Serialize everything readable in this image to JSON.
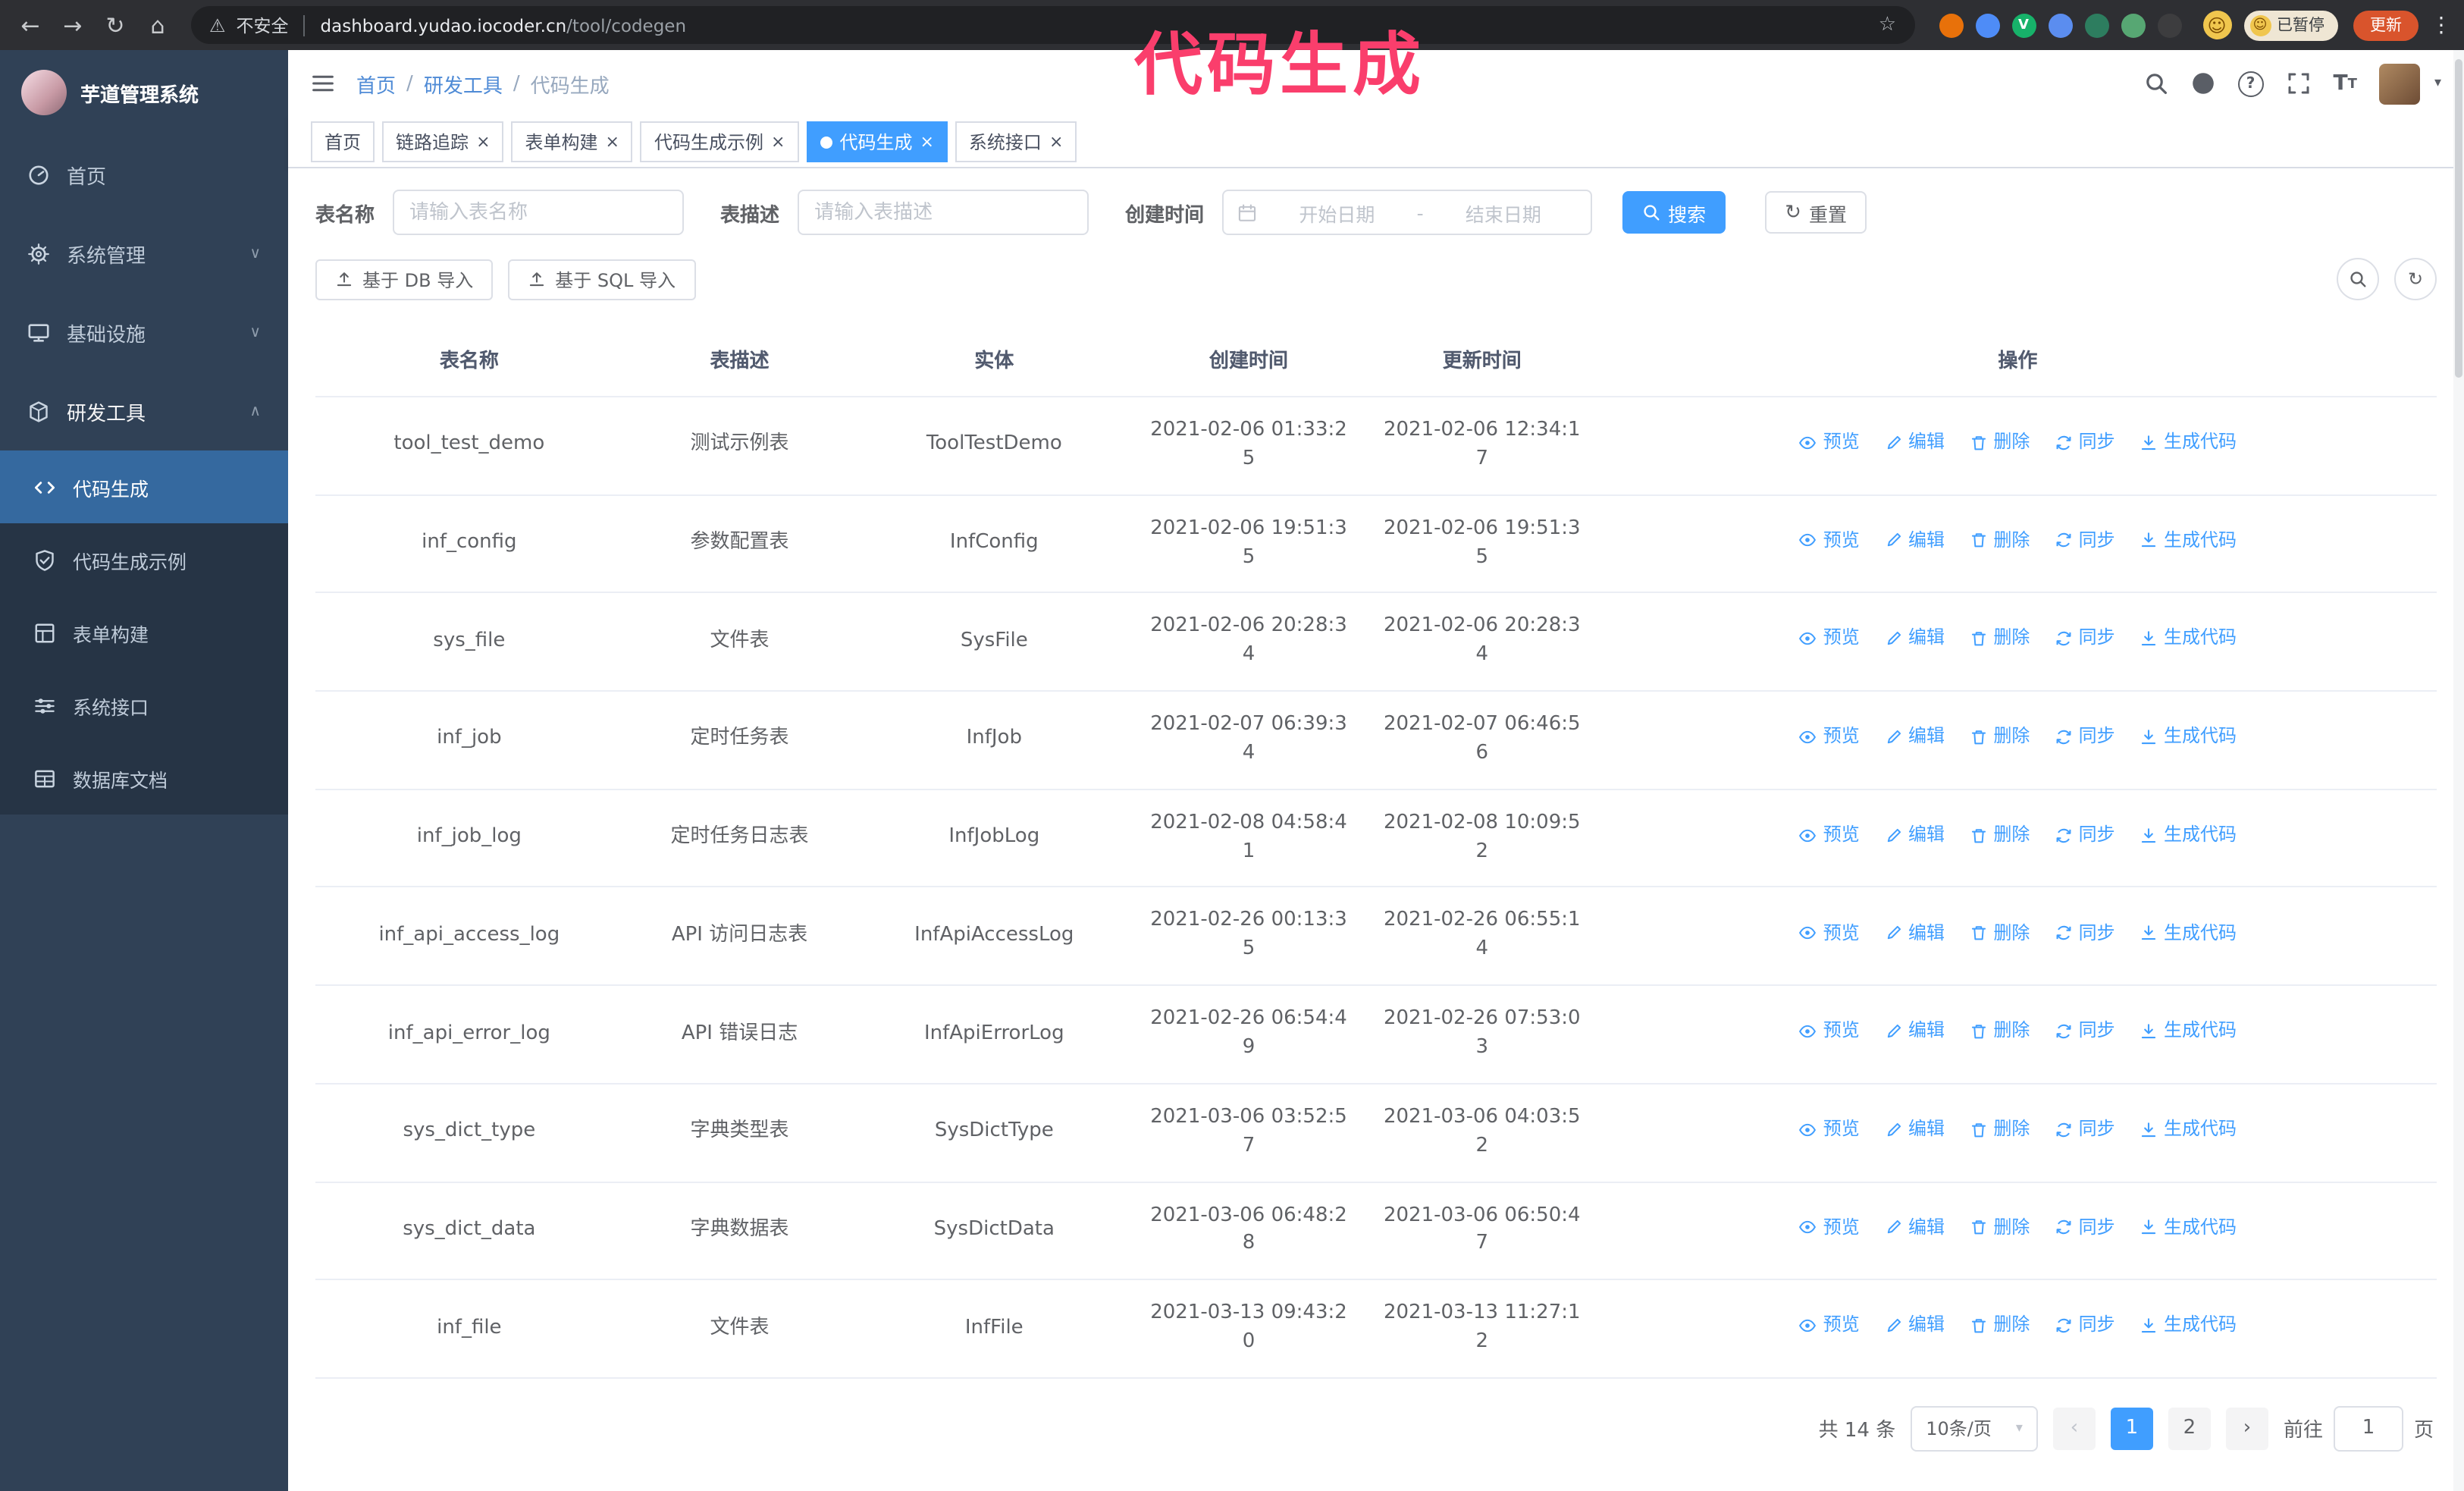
{
  "colors": {
    "accent": "#409eff",
    "sidebar_bg": "#304156",
    "sidebar_sub_bg": "#263445",
    "sidebar_active_bg": "#35699f",
    "annotation": "#fa3e6c",
    "update_button": "#d9542c",
    "chrome_bar": "#2e2f33",
    "omnibox": "#202124"
  },
  "glyphs": {
    "back": "←",
    "forward": "→",
    "reload": "↻",
    "home": "⌂",
    "warning": "⚠",
    "star": "☆",
    "menu_dots": "⋮",
    "caret": "▾",
    "prev": "‹",
    "next": "›",
    "refresh": "↻",
    "close": "×",
    "question": "?",
    "smile": "☺",
    "textsize_big": "T",
    "textsize_small": "T",
    "divider": "|"
  },
  "browser": {
    "security_label": "不安全",
    "url_domain": "dashboard.yudao.iocoder.cn",
    "url_path": "/tool/codegen",
    "paused_badge": "已暂停",
    "update_button": "更新",
    "extensions": [
      {
        "color": "#e8710a",
        "glyph": ""
      },
      {
        "color": "#4e8cf7",
        "glyph": ""
      },
      {
        "color": "#17b26a",
        "glyph": "V"
      },
      {
        "color": "#5b8def",
        "glyph": ""
      },
      {
        "color": "#2d7d5f",
        "glyph": ""
      },
      {
        "color": "#57a773",
        "glyph": ""
      },
      {
        "color": "#3d3d3f",
        "glyph": ""
      }
    ]
  },
  "annotation": {
    "text": "代码生成"
  },
  "sidebar": {
    "logo_title": "芋道管理系统",
    "items": [
      {
        "key": "home",
        "icon": "dash",
        "label": "首页",
        "type": "top"
      },
      {
        "key": "system",
        "icon": "gear",
        "label": "系统管理",
        "type": "top",
        "chevron": "down"
      },
      {
        "key": "infra",
        "icon": "monitor",
        "label": "基础设施",
        "type": "top",
        "chevron": "down"
      },
      {
        "key": "devtools",
        "icon": "tool",
        "label": "研发工具",
        "type": "top",
        "chevron": "up",
        "active": true
      },
      {
        "key": "codegen",
        "icon": "code",
        "label": "代码生成",
        "type": "sub",
        "active": true
      },
      {
        "key": "codegen-example",
        "icon": "shield",
        "label": "代码生成示例",
        "type": "sub"
      },
      {
        "key": "form-build",
        "icon": "form",
        "label": "表单构建",
        "type": "sub"
      },
      {
        "key": "api",
        "icon": "api",
        "label": "系统接口",
        "type": "sub"
      },
      {
        "key": "db-doc",
        "icon": "dbdoc",
        "label": "数据库文档",
        "type": "sub"
      }
    ]
  },
  "header": {
    "breadcrumb": [
      "首页",
      "研发工具",
      "代码生成"
    ]
  },
  "tabs": [
    {
      "key": "home",
      "label": "首页",
      "closable": false
    },
    {
      "key": "trace",
      "label": "链路追踪",
      "closable": true
    },
    {
      "key": "form-build",
      "label": "表单构建",
      "closable": true
    },
    {
      "key": "codegen-example",
      "label": "代码生成示例",
      "closable": true
    },
    {
      "key": "codegen",
      "label": "代码生成",
      "closable": true,
      "active": true
    },
    {
      "key": "api",
      "label": "系统接口",
      "closable": true
    }
  ],
  "filters": {
    "table_name_label": "表名称",
    "table_name_placeholder": "请输入表名称",
    "table_desc_label": "表描述",
    "table_desc_placeholder": "请输入表描述",
    "create_time_label": "创建时间",
    "date_start_placeholder": "开始日期",
    "date_separator": "-",
    "date_end_placeholder": "结束日期",
    "search_button": "搜索",
    "reset_button": "重置"
  },
  "toolbar": {
    "import_db_button": "基于 DB 导入",
    "import_sql_button": "基于 SQL 导入"
  },
  "table": {
    "columns": [
      "表名称",
      "表描述",
      "实体",
      "创建时间",
      "更新时间",
      "操作"
    ],
    "op_labels": {
      "preview": "预览",
      "edit": "编辑",
      "delete": "删除",
      "sync": "同步",
      "generate": "生成代码"
    },
    "rows": [
      {
        "name": "tool_test_demo",
        "desc": "测试示例表",
        "entity": "ToolTestDemo",
        "created": "2021-02-06 01:33:25",
        "updated": "2021-02-06 12:34:17"
      },
      {
        "name": "inf_config",
        "desc": "参数配置表",
        "entity": "InfConfig",
        "created": "2021-02-06 19:51:35",
        "updated": "2021-02-06 19:51:35"
      },
      {
        "name": "sys_file",
        "desc": "文件表",
        "entity": "SysFile",
        "created": "2021-02-06 20:28:34",
        "updated": "2021-02-06 20:28:34"
      },
      {
        "name": "inf_job",
        "desc": "定时任务表",
        "entity": "InfJob",
        "created": "2021-02-07 06:39:34",
        "updated": "2021-02-07 06:46:56"
      },
      {
        "name": "inf_job_log",
        "desc": "定时任务日志表",
        "entity": "InfJobLog",
        "created": "2021-02-08 04:58:41",
        "updated": "2021-02-08 10:09:52"
      },
      {
        "name": "inf_api_access_log",
        "desc": "API 访问日志表",
        "entity": "InfApiAccessLog",
        "created": "2021-02-26 00:13:35",
        "updated": "2021-02-26 06:55:14"
      },
      {
        "name": "inf_api_error_log",
        "desc": "API 错误日志",
        "entity": "InfApiErrorLog",
        "created": "2021-02-26 06:54:49",
        "updated": "2021-02-26 07:53:03"
      },
      {
        "name": "sys_dict_type",
        "desc": "字典类型表",
        "entity": "SysDictType",
        "created": "2021-03-06 03:52:57",
        "updated": "2021-03-06 04:03:52"
      },
      {
        "name": "sys_dict_data",
        "desc": "字典数据表",
        "entity": "SysDictData",
        "created": "2021-03-06 06:48:28",
        "updated": "2021-03-06 06:50:47"
      },
      {
        "name": "inf_file",
        "desc": "文件表",
        "entity": "InfFile",
        "created": "2021-03-13 09:43:20",
        "updated": "2021-03-13 11:27:12"
      }
    ]
  },
  "pagination": {
    "total_text": "共 14 条",
    "page_size": "10条/页",
    "pages": [
      "1",
      "2"
    ],
    "active_page": "1",
    "goto_label": "前往",
    "goto_value": "1",
    "goto_suffix": "页"
  }
}
